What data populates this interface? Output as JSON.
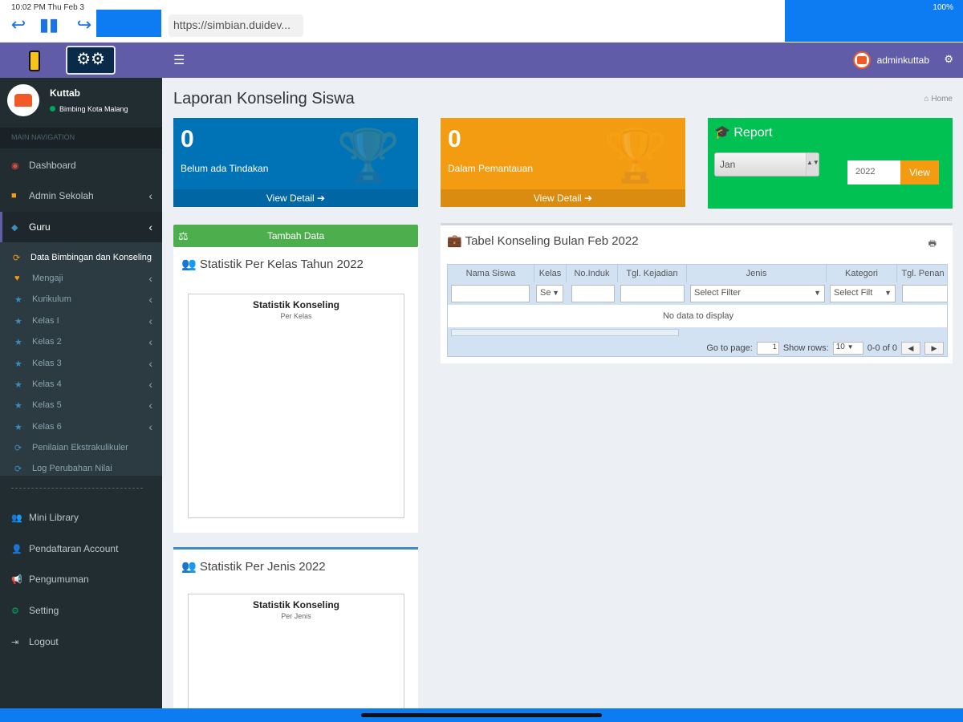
{
  "statusbar": {
    "time": "10:02 PM   Thu Feb 3",
    "battery": "100%"
  },
  "browser": {
    "url": "https://simbian.duidev..."
  },
  "header": {
    "menu_icon": "☰",
    "username": "adminkuttab"
  },
  "user_panel": {
    "name": "Kuttab",
    "subtitle": "Bimbing Kota Malang"
  },
  "sidebar": {
    "nav_header": "MAIN NAVIGATION",
    "items": [
      {
        "label": "Dashboard",
        "icon": "dashboard-icon"
      },
      {
        "label": "Admin Sekolah",
        "icon": "briefcase-icon"
      },
      {
        "label": "Guru",
        "icon": "teacher-icon"
      }
    ],
    "submenu": [
      {
        "label": "Data Bimbingan dan Konseling"
      },
      {
        "label": "Mengaji"
      },
      {
        "label": "Kurikulum"
      },
      {
        "label": "Kelas I"
      },
      {
        "label": "Kelas 2"
      },
      {
        "label": "Kelas 3"
      },
      {
        "label": "Kelas 4"
      },
      {
        "label": "Kelas 5"
      },
      {
        "label": "Kelas 6"
      },
      {
        "label": "Penilaian Ekstrakulikuler"
      },
      {
        "label": "Log Perubahan Nilai"
      }
    ],
    "bottom_items": [
      {
        "label": "Mini Library"
      },
      {
        "label": "Pendaftaran Account"
      },
      {
        "label": "Pengumuman"
      },
      {
        "label": "Setting"
      },
      {
        "label": "Logout"
      }
    ]
  },
  "page": {
    "title": "Laporan Konseling Siswa",
    "breadcrumb": "Home"
  },
  "stats": {
    "belum": {
      "value": "0",
      "label": "Belum ada Tindakan",
      "footer": "View Detail"
    },
    "pantau": {
      "value": "0",
      "label": "Dalam Pemantauan",
      "footer": "View Detail"
    }
  },
  "report": {
    "title": "Report",
    "month": "Jan",
    "year": "2022",
    "button": "View"
  },
  "tambah": {
    "label": "Tambah Data"
  },
  "panel_kelas": {
    "title": "Statistik Per Kelas Tahun 2022",
    "chart_title": "Statistik Konseling",
    "chart_sub": "Per Kelas"
  },
  "panel_jenis": {
    "title": "Statistik Per Jenis 2022",
    "chart_title": "Statistik Konseling",
    "chart_sub": "Per Jenis"
  },
  "table": {
    "title": "Tabel Konseling Bulan Feb 2022",
    "columns": [
      "Nama Siswa",
      "Kelas",
      "No.Induk",
      "Tgl. Kejadian",
      "Jenis",
      "Kategori",
      "Tgl. Penan"
    ],
    "filters": {
      "kelas": "Se",
      "jenis": "Select Filter",
      "kategori": "Select Filt"
    },
    "no_data": "No data to display",
    "pager": {
      "goto_label": "Go to page:",
      "page": "1",
      "rows_label": "Show rows:",
      "rows": "10",
      "range": "0-0 of 0"
    }
  }
}
